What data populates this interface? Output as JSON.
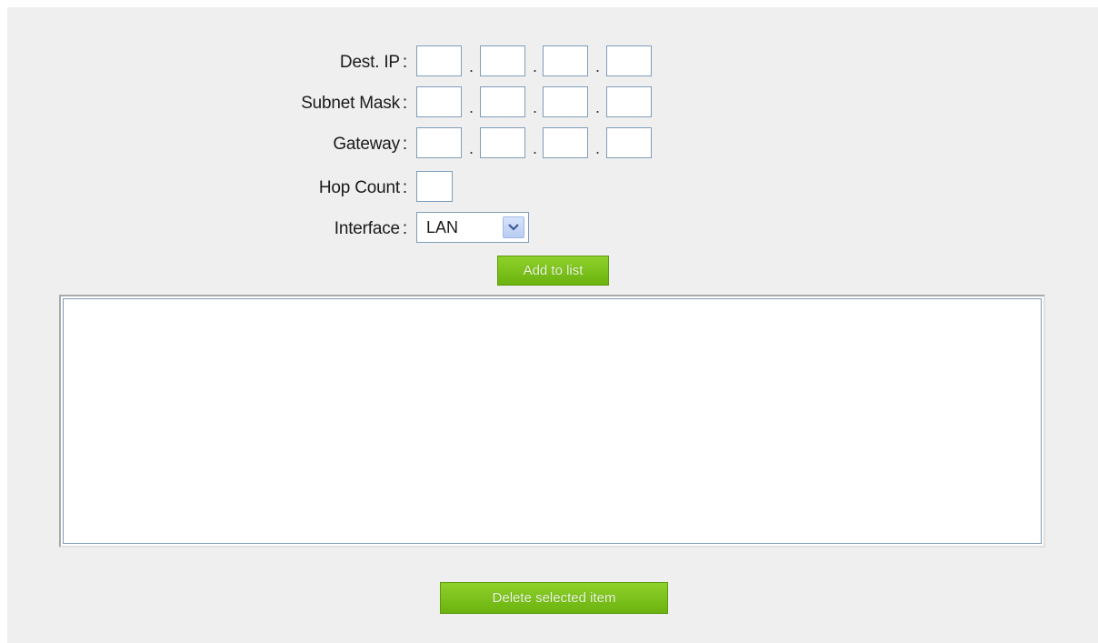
{
  "form": {
    "dest_ip": {
      "label": "Dest. IP",
      "colon": ":",
      "octets": [
        "",
        "",
        "",
        ""
      ]
    },
    "subnet_mask": {
      "label": "Subnet Mask",
      "colon": ":",
      "octets": [
        "",
        "",
        "",
        ""
      ]
    },
    "gateway": {
      "label": "Gateway",
      "colon": ":",
      "octets": [
        "",
        "",
        "",
        ""
      ]
    },
    "hop_count": {
      "label": "Hop Count",
      "colon": ":",
      "value": ""
    },
    "interface": {
      "label": "Interface",
      "colon": ":",
      "selected": "LAN"
    },
    "dot": "."
  },
  "buttons": {
    "add_to_list": "Add to list",
    "delete_selected": "Delete selected item"
  },
  "route_list": {
    "items": []
  },
  "icons": {
    "dropdown": "chevron-down-icon"
  },
  "colors": {
    "panel_bg": "#efefef",
    "button_green": "#7cc21c",
    "input_border": "#7f9db9"
  }
}
